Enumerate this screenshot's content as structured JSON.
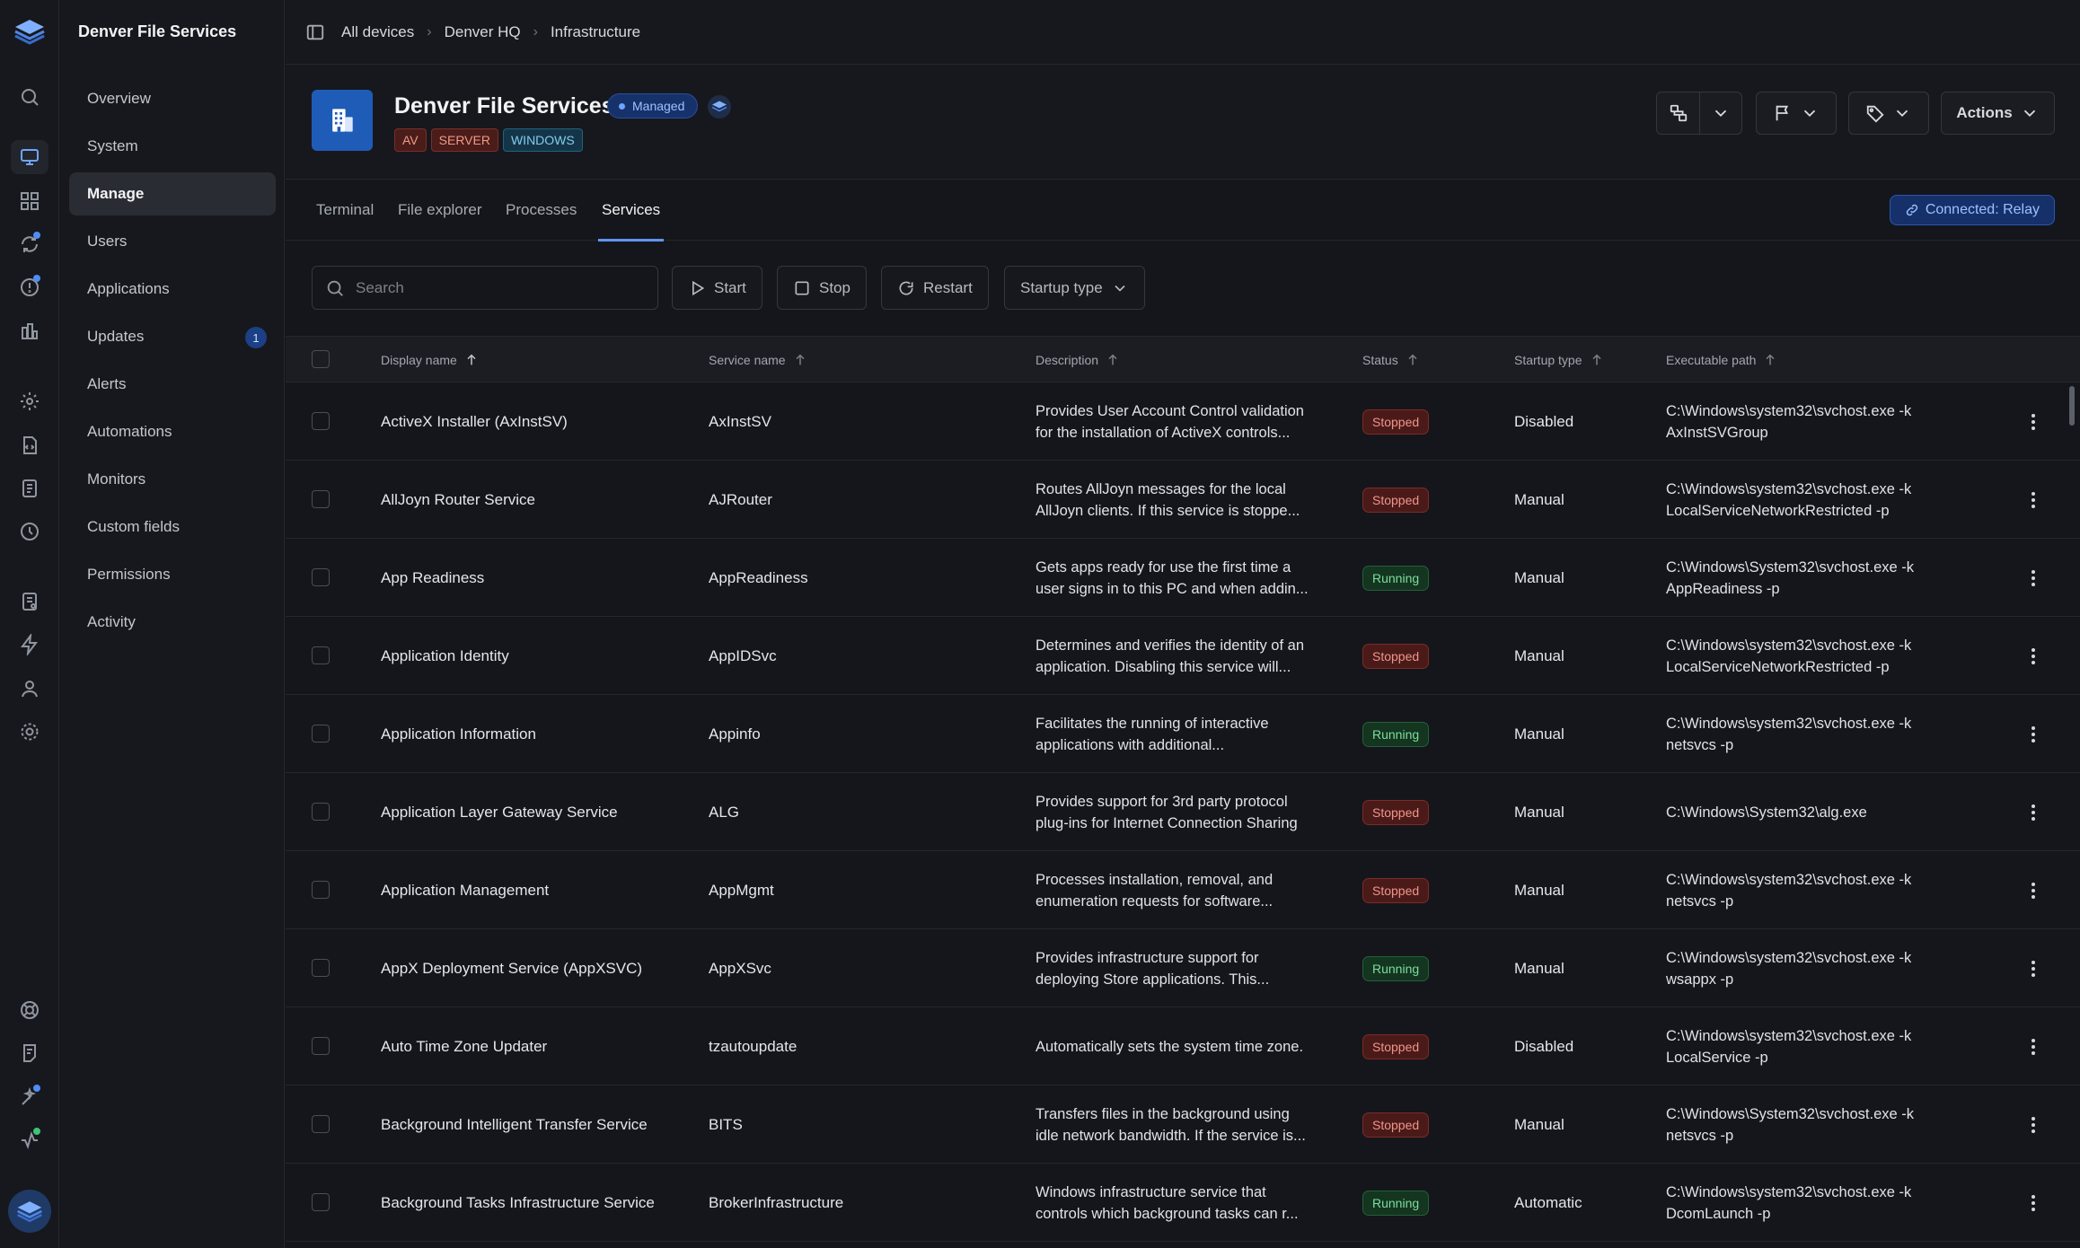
{
  "org_name": "Denver File Services",
  "breadcrumb": [
    "All devices",
    "Denver HQ",
    "Infrastructure"
  ],
  "device": {
    "name": "Denver File Services",
    "status_badge": "Managed",
    "tags": [
      "AV",
      "SERVER",
      "WINDOWS"
    ],
    "actions_label": "Actions"
  },
  "nav": {
    "items": [
      {
        "label": "Overview"
      },
      {
        "label": "System"
      },
      {
        "label": "Manage",
        "active": true
      },
      {
        "label": "Users"
      },
      {
        "label": "Applications"
      },
      {
        "label": "Updates",
        "badge": "1"
      },
      {
        "label": "Alerts"
      },
      {
        "label": "Automations"
      },
      {
        "label": "Monitors"
      },
      {
        "label": "Custom fields"
      },
      {
        "label": "Permissions"
      },
      {
        "label": "Activity"
      }
    ]
  },
  "tabs": [
    {
      "label": "Terminal"
    },
    {
      "label": "File explorer"
    },
    {
      "label": "Processes"
    },
    {
      "label": "Services",
      "active": true
    }
  ],
  "connection": "Connected: Relay",
  "toolbar": {
    "search_placeholder": "Search",
    "start": "Start",
    "stop": "Stop",
    "restart": "Restart",
    "startup_type": "Startup type"
  },
  "columns": {
    "display_name": "Display name",
    "service_name": "Service name",
    "description": "Description",
    "status": "Status",
    "startup_type": "Startup type",
    "executable_path": "Executable path"
  },
  "colors": {
    "accent": "#5f95f0",
    "stopped": "#f0958a",
    "running": "#7ddca0",
    "device_icon_bg": "#1f5cb8"
  },
  "services": [
    {
      "display": "ActiveX Installer (AxInstSV)",
      "service": "AxInstSV",
      "desc1": "Provides User Account Control validation",
      "desc2": "for the installation of ActiveX controls...",
      "status": "Stopped",
      "startup": "Disabled",
      "path1": "C:\\Windows\\system32\\svchost.exe -k",
      "path2": "AxInstSVGroup"
    },
    {
      "display": "AllJoyn Router Service",
      "service": "AJRouter",
      "desc1": "Routes AllJoyn messages for the local",
      "desc2": "AllJoyn clients. If this service is stoppe...",
      "status": "Stopped",
      "startup": "Manual",
      "path1": "C:\\Windows\\system32\\svchost.exe -k",
      "path2": "LocalServiceNetworkRestricted -p"
    },
    {
      "display": "App Readiness",
      "service": "AppReadiness",
      "desc1": "Gets apps ready for use the first time a",
      "desc2": "user signs in to this PC and when addin...",
      "status": "Running",
      "startup": "Manual",
      "path1": "C:\\Windows\\System32\\svchost.exe -k",
      "path2": "AppReadiness -p"
    },
    {
      "display": "Application Identity",
      "service": "AppIDSvc",
      "desc1": "Determines and verifies the identity of an",
      "desc2": "application. Disabling this service will...",
      "status": "Stopped",
      "startup": "Manual",
      "path1": "C:\\Windows\\system32\\svchost.exe -k",
      "path2": "LocalServiceNetworkRestricted -p"
    },
    {
      "display": "Application Information",
      "service": "Appinfo",
      "desc1": "Facilitates the running of interactive",
      "desc2": "applications with additional...",
      "status": "Running",
      "startup": "Manual",
      "path1": "C:\\Windows\\system32\\svchost.exe -k",
      "path2": "netsvcs -p"
    },
    {
      "display": "Application Layer Gateway Service",
      "service": "ALG",
      "desc1": "Provides support for 3rd party protocol",
      "desc2": "plug-ins for Internet Connection Sharing",
      "status": "Stopped",
      "startup": "Manual",
      "path1": "C:\\Windows\\System32\\alg.exe",
      "path2": ""
    },
    {
      "display": "Application Management",
      "service": "AppMgmt",
      "desc1": "Processes installation, removal, and",
      "desc2": "enumeration requests for software...",
      "status": "Stopped",
      "startup": "Manual",
      "path1": "C:\\Windows\\system32\\svchost.exe -k",
      "path2": "netsvcs -p"
    },
    {
      "display": "AppX Deployment Service (AppXSVC)",
      "service": "AppXSvc",
      "desc1": "Provides infrastructure support for",
      "desc2": "deploying Store applications. This...",
      "status": "Running",
      "startup": "Manual",
      "path1": "C:\\Windows\\system32\\svchost.exe -k",
      "path2": "wsappx -p"
    },
    {
      "display": "Auto Time Zone Updater",
      "service": "tzautoupdate",
      "desc1": "Automatically sets the system time zone.",
      "desc2": "",
      "status": "Stopped",
      "startup": "Disabled",
      "path1": "C:\\Windows\\system32\\svchost.exe -k",
      "path2": "LocalService -p"
    },
    {
      "display": "Background Intelligent Transfer Service",
      "service": "BITS",
      "desc1": "Transfers files in the background using",
      "desc2": "idle network bandwidth. If the service is...",
      "status": "Stopped",
      "startup": "Manual",
      "path1": "C:\\Windows\\System32\\svchost.exe -k",
      "path2": "netsvcs -p"
    },
    {
      "display": "Background Tasks Infrastructure Service",
      "service": "BrokerInfrastructure",
      "desc1": "Windows infrastructure service that",
      "desc2": "controls which background tasks can r...",
      "status": "Running",
      "startup": "Automatic",
      "path1": "C:\\Windows\\system32\\svchost.exe -k",
      "path2": "DcomLaunch -p"
    }
  ]
}
